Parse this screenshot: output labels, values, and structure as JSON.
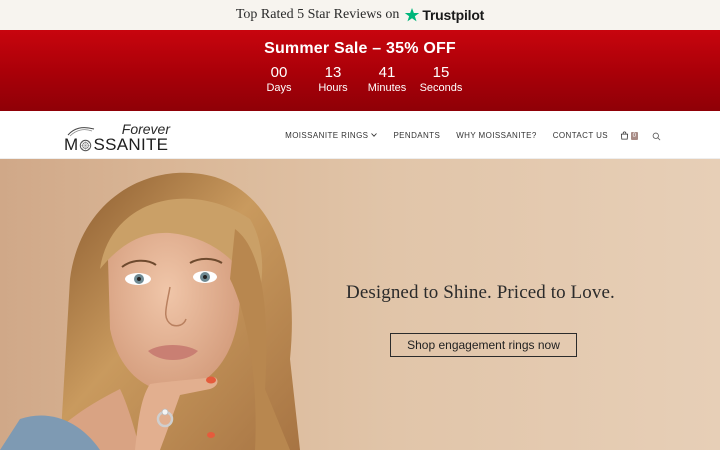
{
  "trustbar": {
    "text": "Top Rated 5 Star Reviews on",
    "brand": "Trustpilot",
    "star_color": "#00b67a"
  },
  "sale": {
    "title": "Summer Sale – 35% OFF",
    "countdown": [
      {
        "value": "00",
        "label": "Days"
      },
      {
        "value": "13",
        "label": "Hours"
      },
      {
        "value": "41",
        "label": "Minutes"
      },
      {
        "value": "15",
        "label": "Seconds"
      }
    ],
    "color": "#b3020b"
  },
  "header": {
    "logo": {
      "top": "Forever",
      "bottom_left": "M",
      "bottom_right": "SSANITE"
    },
    "nav": [
      {
        "label": "MOISSANITE RINGS",
        "has_dropdown": true
      },
      {
        "label": "PENDANTS"
      },
      {
        "label": "WHY MOISSANITE?"
      },
      {
        "label": "CONTACT US"
      }
    ],
    "cart_count": "0",
    "cart_badge_color": "#a88b85"
  },
  "hero": {
    "tagline": "Designed to Shine. Priced to Love.",
    "cta_label": "Shop engagement rings now",
    "background": "#dfc2a5"
  }
}
